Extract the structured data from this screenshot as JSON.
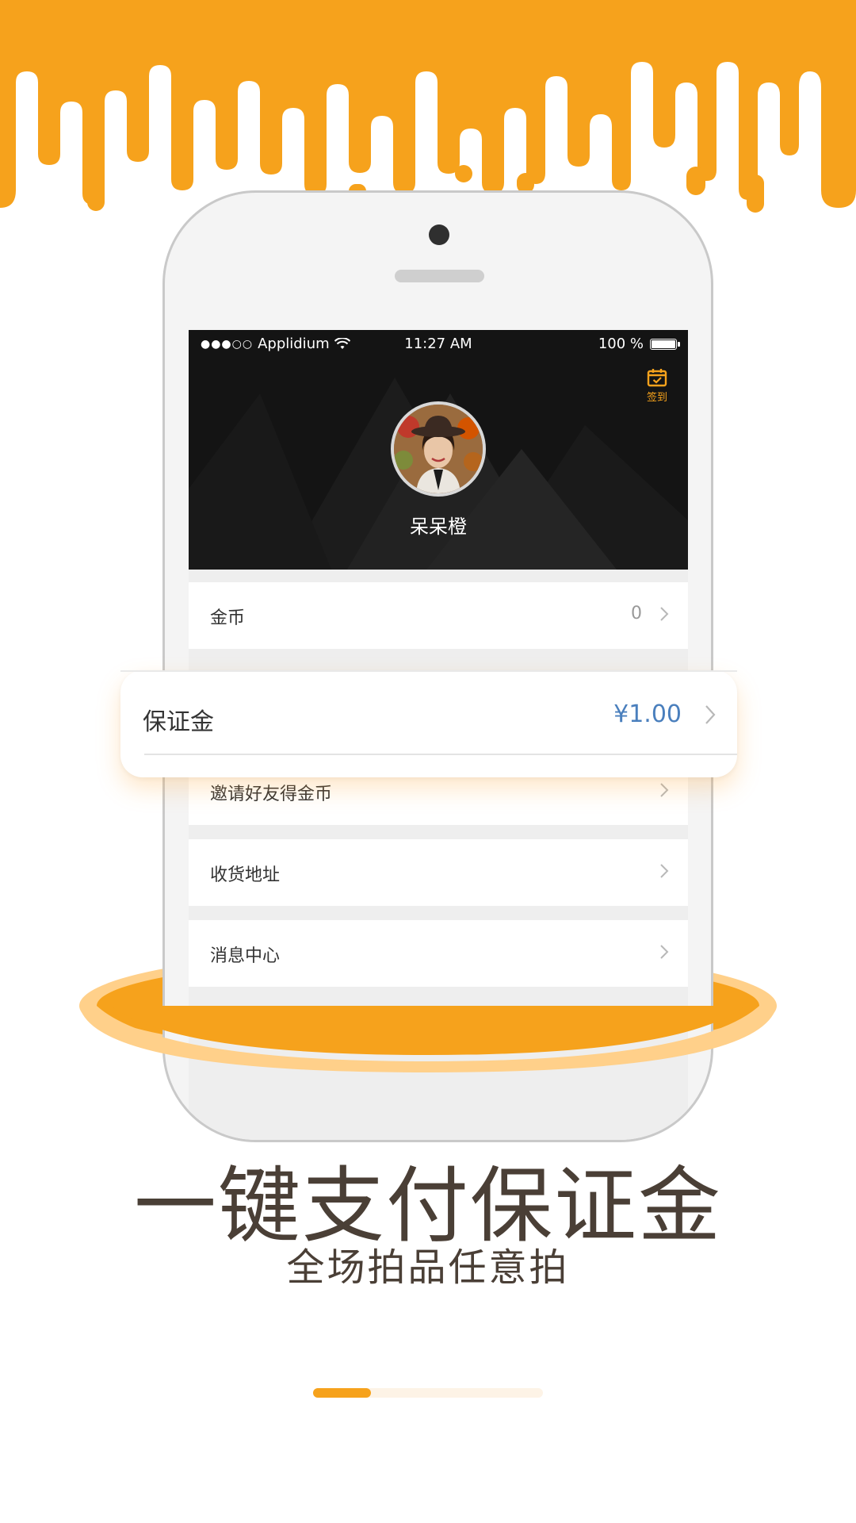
{
  "colors": {
    "accent": "#f6a21c",
    "accent_light": "#ffd08a",
    "text_dark": "#4a3f36",
    "deposit_value": "#4a7fbd"
  },
  "status_bar": {
    "carrier": "Applidium",
    "time": "11:27 AM",
    "battery": "100 %",
    "signal_icon": "signal-dots-icon",
    "wifi_icon": "wifi-icon",
    "battery_icon": "battery-icon"
  },
  "profile": {
    "checkin_label": "签到",
    "checkin_icon": "calendar-check-icon",
    "username": "呆呆橙"
  },
  "menu": {
    "items": [
      {
        "label": "金币",
        "value": "0"
      },
      {
        "label": "邀请好友得金币",
        "value": ""
      },
      {
        "label": "收货地址",
        "value": ""
      },
      {
        "label": "消息中心",
        "value": ""
      }
    ]
  },
  "highlight_card": {
    "label": "保证金",
    "value": "¥1.00"
  },
  "promo": {
    "headline": "一键支付保证金",
    "subline": "全场拍品任意拍"
  },
  "pager": {
    "current_page": 1,
    "total_pages": 4,
    "progress_fraction": 0.25
  }
}
